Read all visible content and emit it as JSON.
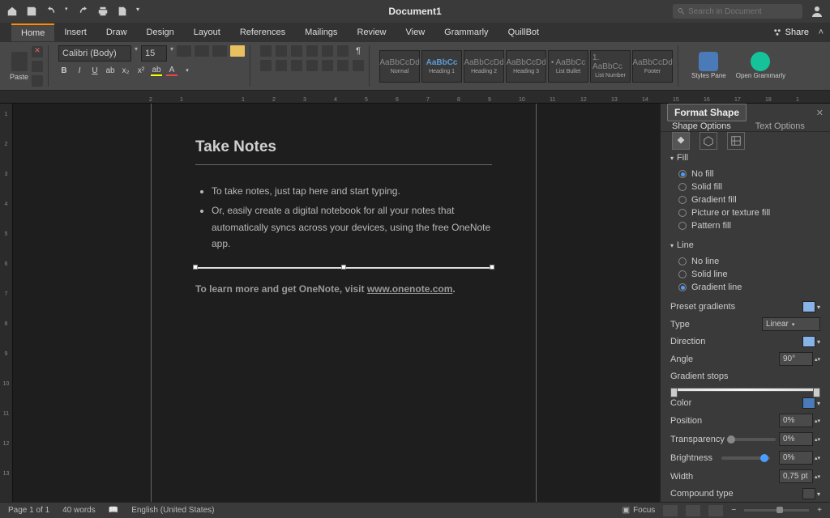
{
  "titlebar": {
    "doc_title": "Document1",
    "search_placeholder": "Search in Document"
  },
  "ribbon_tabs": [
    "Home",
    "Insert",
    "Draw",
    "Design",
    "Layout",
    "References",
    "Mailings",
    "Review",
    "View",
    "Grammarly",
    "QuillBot"
  ],
  "share_label": "Share",
  "paste_label": "Paste",
  "font": {
    "family": "Calibri (Body)",
    "size": "15"
  },
  "styles": [
    {
      "name": "Normal",
      "prev": "AaBbCcDd"
    },
    {
      "name": "Heading 1",
      "prev": "AaBbCc"
    },
    {
      "name": "Heading 2",
      "prev": "AaBbCcDd"
    },
    {
      "name": "Heading 3",
      "prev": "AaBbCcDd"
    },
    {
      "name": "List Bullet",
      "prev": "• AaBbCc"
    },
    {
      "name": "List Number",
      "prev": "1. AaBbCc"
    },
    {
      "name": "Footer",
      "prev": "AaBbCcDd"
    }
  ],
  "rb_styles_pane": "Styles\nPane",
  "rb_grammarly": "Open\nGrammarly",
  "ruler_h": [
    "2",
    "1",
    "",
    "1",
    "2",
    "3",
    "4",
    "5",
    "6",
    "7",
    "8",
    "9",
    "10",
    "11",
    "12",
    "13",
    "14",
    "15",
    "16",
    "17",
    "18",
    "1"
  ],
  "ruler_v": [
    "1",
    "2",
    "3",
    "4",
    "5",
    "6",
    "7",
    "8",
    "9",
    "10",
    "11",
    "12",
    "13"
  ],
  "doc": {
    "heading": "Take Notes",
    "bullet1": "To take notes, just tap here and start typing.",
    "bullet2": "Or, easily create a digital notebook for all your notes that automatically syncs across your devices, using the free OneNote app.",
    "learn_pre": "To learn more and get OneNote, visit ",
    "learn_link": "www.onenote.com",
    "learn_post": "."
  },
  "pane": {
    "title": "Format Shape",
    "shape_opts": "Shape Options",
    "text_opts": "Text Options",
    "fill_header": "Fill",
    "fill_opts": [
      "No fill",
      "Solid fill",
      "Gradient fill",
      "Picture or texture fill",
      "Pattern fill"
    ],
    "fill_selected": 0,
    "line_header": "Line",
    "line_opts": [
      "No line",
      "Solid line",
      "Gradient line"
    ],
    "line_selected": 2,
    "preset": "Preset gradients",
    "type_lbl": "Type",
    "type_val": "Linear",
    "dir": "Direction",
    "angle_lbl": "Angle",
    "angle_val": "90°",
    "stops_lbl": "Gradient stops",
    "color_lbl": "Color",
    "pos_lbl": "Position",
    "pos_val": "0%",
    "trans_lbl": "Transparency",
    "trans_val": "0%",
    "bright_lbl": "Brightness",
    "bright_val": "0%",
    "width_lbl": "Width",
    "width_val": "0,75 pt",
    "comp_lbl": "Compound type"
  },
  "status": {
    "page": "Page 1 of 1",
    "words": "40 words",
    "lang": "English (United States)",
    "focus": "Focus"
  }
}
